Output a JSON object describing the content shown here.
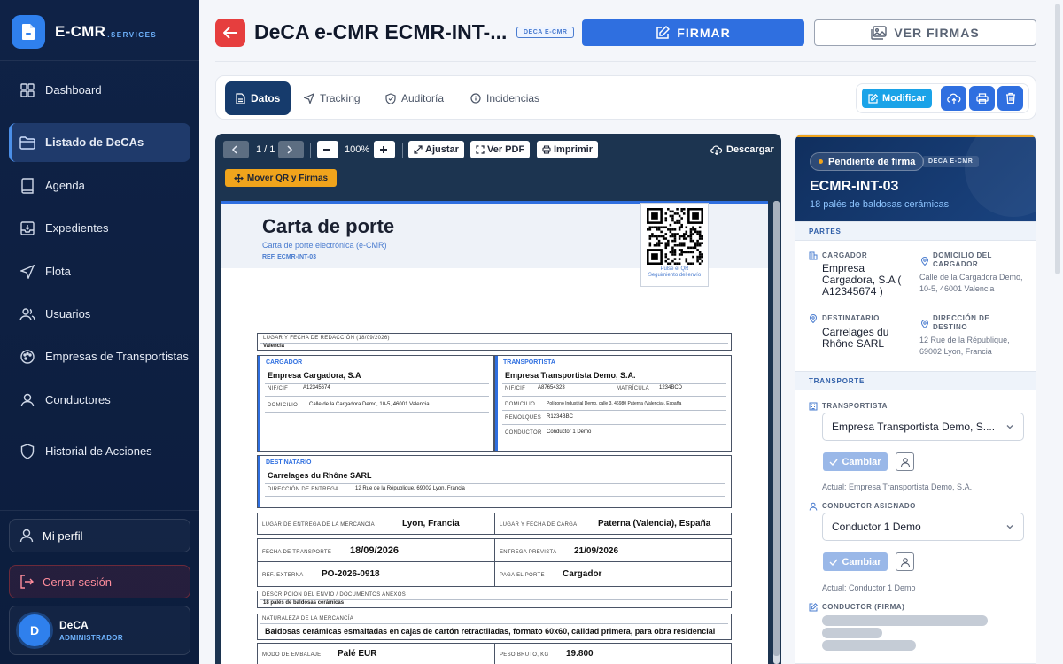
{
  "sidebar": {
    "brand": "E-CMR",
    "brand_sub": ".SERVICES",
    "items": [
      {
        "label": "Dashboard"
      },
      {
        "label": "Listado de DeCAs"
      },
      {
        "label": "Agenda"
      },
      {
        "label": "Expedientes"
      },
      {
        "label": "Flota"
      },
      {
        "label": "Usuarios"
      },
      {
        "label": "Empresas de Transportistas"
      },
      {
        "label": "Conductores"
      },
      {
        "label": "Historial de Acciones"
      }
    ],
    "profile": "Mi perfil",
    "logout": "Cerrar sesión",
    "user": {
      "initial": "D",
      "name": "DeCA",
      "role": "ADMINISTRADOR"
    }
  },
  "header": {
    "title": "DeCA e-CMR ECMR-INT-...",
    "tag": "DECA E-CMR",
    "sign": "FIRMAR",
    "view_signatures": "VER FIRMAS"
  },
  "tabs": [
    {
      "label": "Datos"
    },
    {
      "label": "Tracking"
    },
    {
      "label": "Auditoría"
    },
    {
      "label": "Incidencias"
    }
  ],
  "toolbar": {
    "modify": "Modificar"
  },
  "viewer": {
    "page": "1 / 1",
    "zoom": "100%",
    "fit": "Ajustar",
    "view_pdf": "Ver PDF",
    "print": "Imprimir",
    "download": "Descargar",
    "move_qr": "Mover QR y Firmas"
  },
  "document": {
    "title": "Carta de porte",
    "subtitle": "Carta de porte electrónica (e-CMR)",
    "ref": "REF. ECMR-INT-03",
    "qr_caption": "Pulse el QR\nSeguimiento del envío",
    "place_date_label": "LUGAR Y FECHA DE REDACCIÓN (18/09/2026)",
    "place_date_value": "Valencia",
    "cargador_head": "CARGADOR",
    "cargador_name": "Empresa Cargadora, S.A",
    "nif_label": "NIF/CIF",
    "cargador_nif": "A12345674",
    "domicilio_label": "DOMICILIO",
    "cargador_domicilio": "Calle de la Cargadora Demo, 10-5, 46001 Valencia",
    "transportista_head": "TRANSPORTISTA",
    "transportista_name": "Empresa Transportista Demo, S.A.",
    "transportista_nif": "A87654323",
    "matricula_label": "MATRÍCULA",
    "matricula": "1234BCD",
    "transportista_domicilio": "Polígono Industrial Demo, calle 3, 46980 Paterna (Valencia), España",
    "remolques_label": "REMOLQUES",
    "remolques": "R1234BBC",
    "conductor_label": "CONDUCTOR",
    "conductor": "Conductor 1 Demo",
    "destinatario_head": "DESTINATARIO",
    "destinatario_name": "Carrelages du Rhône SARL",
    "dir_entrega_label": "DIRECCIÓN DE ENTREGA",
    "dir_entrega": "12 Rue de la République, 69002 Lyon, Francia",
    "lugar_entrega_label": "LUGAR DE ENTREGA DE LA MERCANCÍA",
    "lugar_entrega": "Lyon, Francia",
    "lugar_carga_label": "LUGAR Y FECHA DE CARGA",
    "lugar_carga": "Paterna (Valencia), España",
    "fecha_transporte_label": "FECHA DE TRANSPORTE",
    "fecha_transporte": "18/09/2026",
    "entrega_prevista_label": "ENTREGA PREVISTA",
    "entrega_prevista": "21/09/2026",
    "ref_externa_label": "REF. EXTERNA",
    "ref_externa": "PO-2026-0918",
    "paga_label": "PAGA EL PORTE",
    "paga": "Cargador",
    "descripcion_label": "DESCRIPCIÓN DEL ENVÍO / DOCUMENTOS ANEXOS",
    "descripcion": "18 palés de baldosas cerámicas",
    "naturaleza_label": "NATURALEZA DE LA MERCANCÍA",
    "naturaleza": "Baldosas cerámicas esmaltadas en cajas de cartón retractiladas, formato 60x60, calidad primera, para obra residencial",
    "embalaje_label": "MODO DE EMBALAJE",
    "embalaje": "Palé EUR",
    "peso_label": "PESO BRUTO, KG",
    "peso": "19.800"
  },
  "panel": {
    "status": "Pendiente de firma",
    "tag": "DECA E-CMR",
    "id": "ECMR-INT-03",
    "description": "18 palés de baldosas cerámicas",
    "partes": "PARTES",
    "cargador_label": "CARGADOR",
    "cargador": "Empresa Cargadora, S.A ( A12345674 )",
    "domicilio_cargador_label": "DOMICILIO DEL CARGADOR",
    "domicilio_cargador": "Calle de la Cargadora Demo, 10-5, 46001 Valencia",
    "destinatario_label": "DESTINATARIO",
    "destinatario": "Carrelages du Rhône SARL",
    "direccion_destino_label": "DIRECCIÓN DE DESTINO",
    "direccion_destino": "12 Rue de la République, 69002 Lyon, Francia",
    "transporte": "TRANSPORTE",
    "transportista_label": "TRANSPORTISTA",
    "transportista_select": "Empresa Transportista Demo, S....",
    "cambiar": "Cambiar",
    "actual_transportista": "Actual: Empresa Transportista Demo, S.A.",
    "conductor_label": "CONDUCTOR ASIGNADO",
    "conductor_select": "Conductor 1 Demo",
    "actual_conductor": "Actual: Conductor 1 Demo",
    "conductor_firma_label": "CONDUCTOR (FIRMA)"
  },
  "colors": {
    "accent": "#2f6fe0",
    "sidebar": "#0f2246",
    "danger": "#e63e3e",
    "warning": "#f0a41c"
  }
}
